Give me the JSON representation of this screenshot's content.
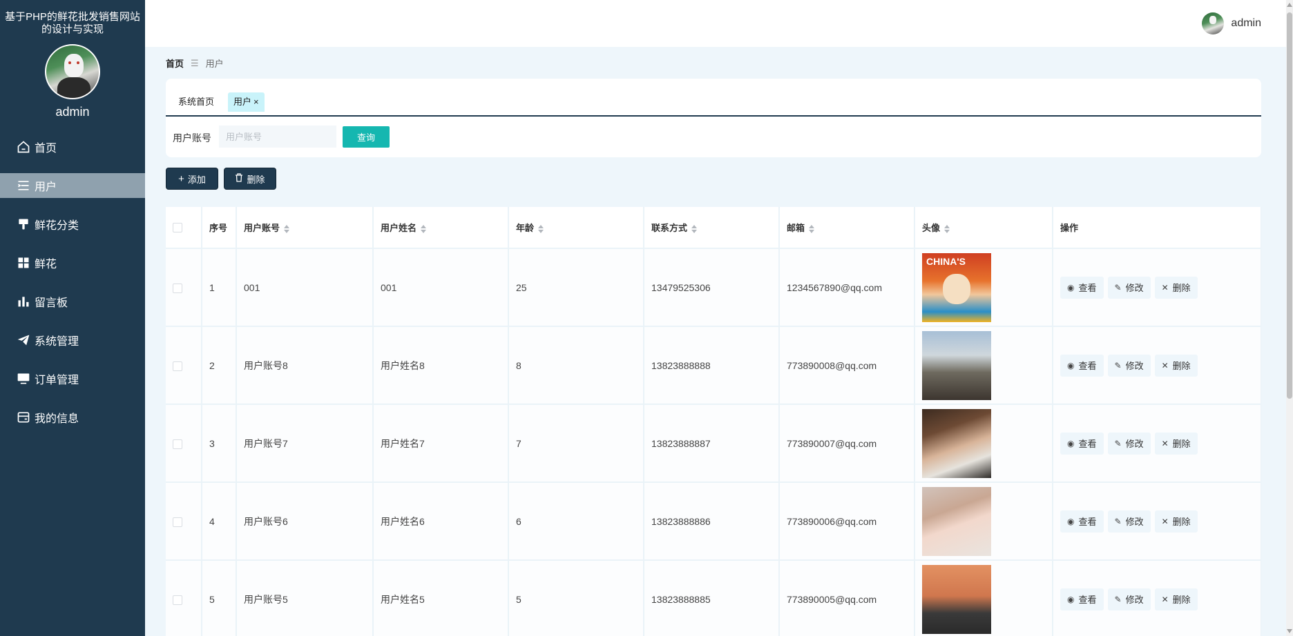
{
  "sidebar": {
    "site_title": "基于PHP的鲜花批发销售网站的设计与实现",
    "admin_name": "admin",
    "items": [
      {
        "label": "首页",
        "icon": "home-icon"
      },
      {
        "label": "用户",
        "icon": "list-icon",
        "active": true
      },
      {
        "label": "鲜花分类",
        "icon": "paint-brush-icon"
      },
      {
        "label": "鲜花",
        "icon": "grid-icon"
      },
      {
        "label": "留言板",
        "icon": "bar-chart-icon"
      },
      {
        "label": "系统管理",
        "icon": "send-icon"
      },
      {
        "label": "订单管理",
        "icon": "monitor-icon"
      },
      {
        "label": "我的信息",
        "icon": "wallet-icon"
      }
    ],
    "colors": {
      "background": "#1f3a4f",
      "active": "#8fa1ae"
    }
  },
  "header": {
    "user_name": "admin"
  },
  "breadcrumb": {
    "home": "首页",
    "current": "用户"
  },
  "tabs": [
    {
      "label": "系统首页"
    },
    {
      "label": "用户",
      "closable": true,
      "close": "×"
    }
  ],
  "search": {
    "label": "用户账号",
    "placeholder": "用户账号",
    "button": "查询"
  },
  "actions": {
    "add": "添加",
    "delete": "删除"
  },
  "table": {
    "headers": {
      "index": "序号",
      "account": "用户账号",
      "name": "用户姓名",
      "age": "年龄",
      "phone": "联系方式",
      "email": "邮箱",
      "avatar": "头像",
      "ops": "操作"
    },
    "rows": [
      {
        "index": "1",
        "account": "001",
        "name": "001",
        "age": "25",
        "phone": "13479525306",
        "email": "1234567890@qq.com"
      },
      {
        "index": "2",
        "account": "用户账号8",
        "name": "用户姓名8",
        "age": "8",
        "phone": "13823888888",
        "email": "773890008@qq.com"
      },
      {
        "index": "3",
        "account": "用户账号7",
        "name": "用户姓名7",
        "age": "7",
        "phone": "13823888887",
        "email": "773890007@qq.com"
      },
      {
        "index": "4",
        "account": "用户账号6",
        "name": "用户姓名6",
        "age": "6",
        "phone": "13823888886",
        "email": "773890006@qq.com"
      },
      {
        "index": "5",
        "account": "用户账号5",
        "name": "用户姓名5",
        "age": "5",
        "phone": "13823888885",
        "email": "773890005@qq.com"
      }
    ],
    "row_actions": {
      "view": "查看",
      "edit": "修改",
      "delete": "删除"
    },
    "avatar_text_row1": "CHINA'S"
  },
  "colors": {
    "accent": "#15b7b0",
    "dark": "#1f3a4f",
    "page_bg": "#eef6fb"
  }
}
